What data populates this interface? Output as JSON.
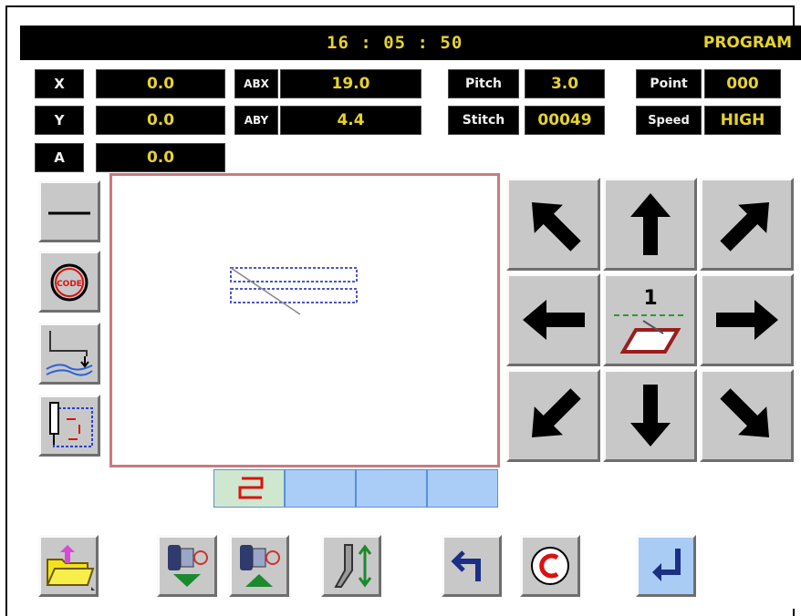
{
  "header": {
    "time": "16 : 05 : 50",
    "mode": "PROGRAM"
  },
  "fields": {
    "x_label": "X",
    "x_value": "0.0",
    "y_label": "Y",
    "y_value": "0.0",
    "a_label": "A",
    "a_value": "0.0",
    "abx_label": "ABX",
    "abx_value": "19.0",
    "aby_label": "ABY",
    "aby_value": "4.4",
    "pitch_label": "Pitch",
    "pitch_value": "3.0",
    "stitch_label": "Stitch",
    "stitch_value": "00049",
    "point_label": "Point",
    "point_value": "000",
    "speed_label": "Speed",
    "speed_value": "HIGH"
  },
  "jog": {
    "speed_step": "1"
  },
  "left_tools": {
    "code_text": "CODE"
  },
  "colors": {
    "bar": "#000000",
    "value_text": "#e6d32c",
    "canvas_border": "#c97a80",
    "tab_fill": "#a9cdf6",
    "enter_fill": "#a8ccf4",
    "button_gray": "#c8c8c8"
  },
  "icons": [
    "line-icon",
    "code-icon",
    "needle-height-icon",
    "trace-frame-icon",
    "arrow-up-left-icon",
    "arrow-up-icon",
    "arrow-up-right-icon",
    "arrow-left-icon",
    "jog-speed-icon",
    "arrow-right-icon",
    "arrow-down-left-icon",
    "arrow-down-icon",
    "arrow-down-right-icon",
    "open-folder-icon",
    "bobbin-down-icon",
    "bobbin-up-icon",
    "presser-foot-icon",
    "undo-icon",
    "clear-icon",
    "enter-icon"
  ]
}
